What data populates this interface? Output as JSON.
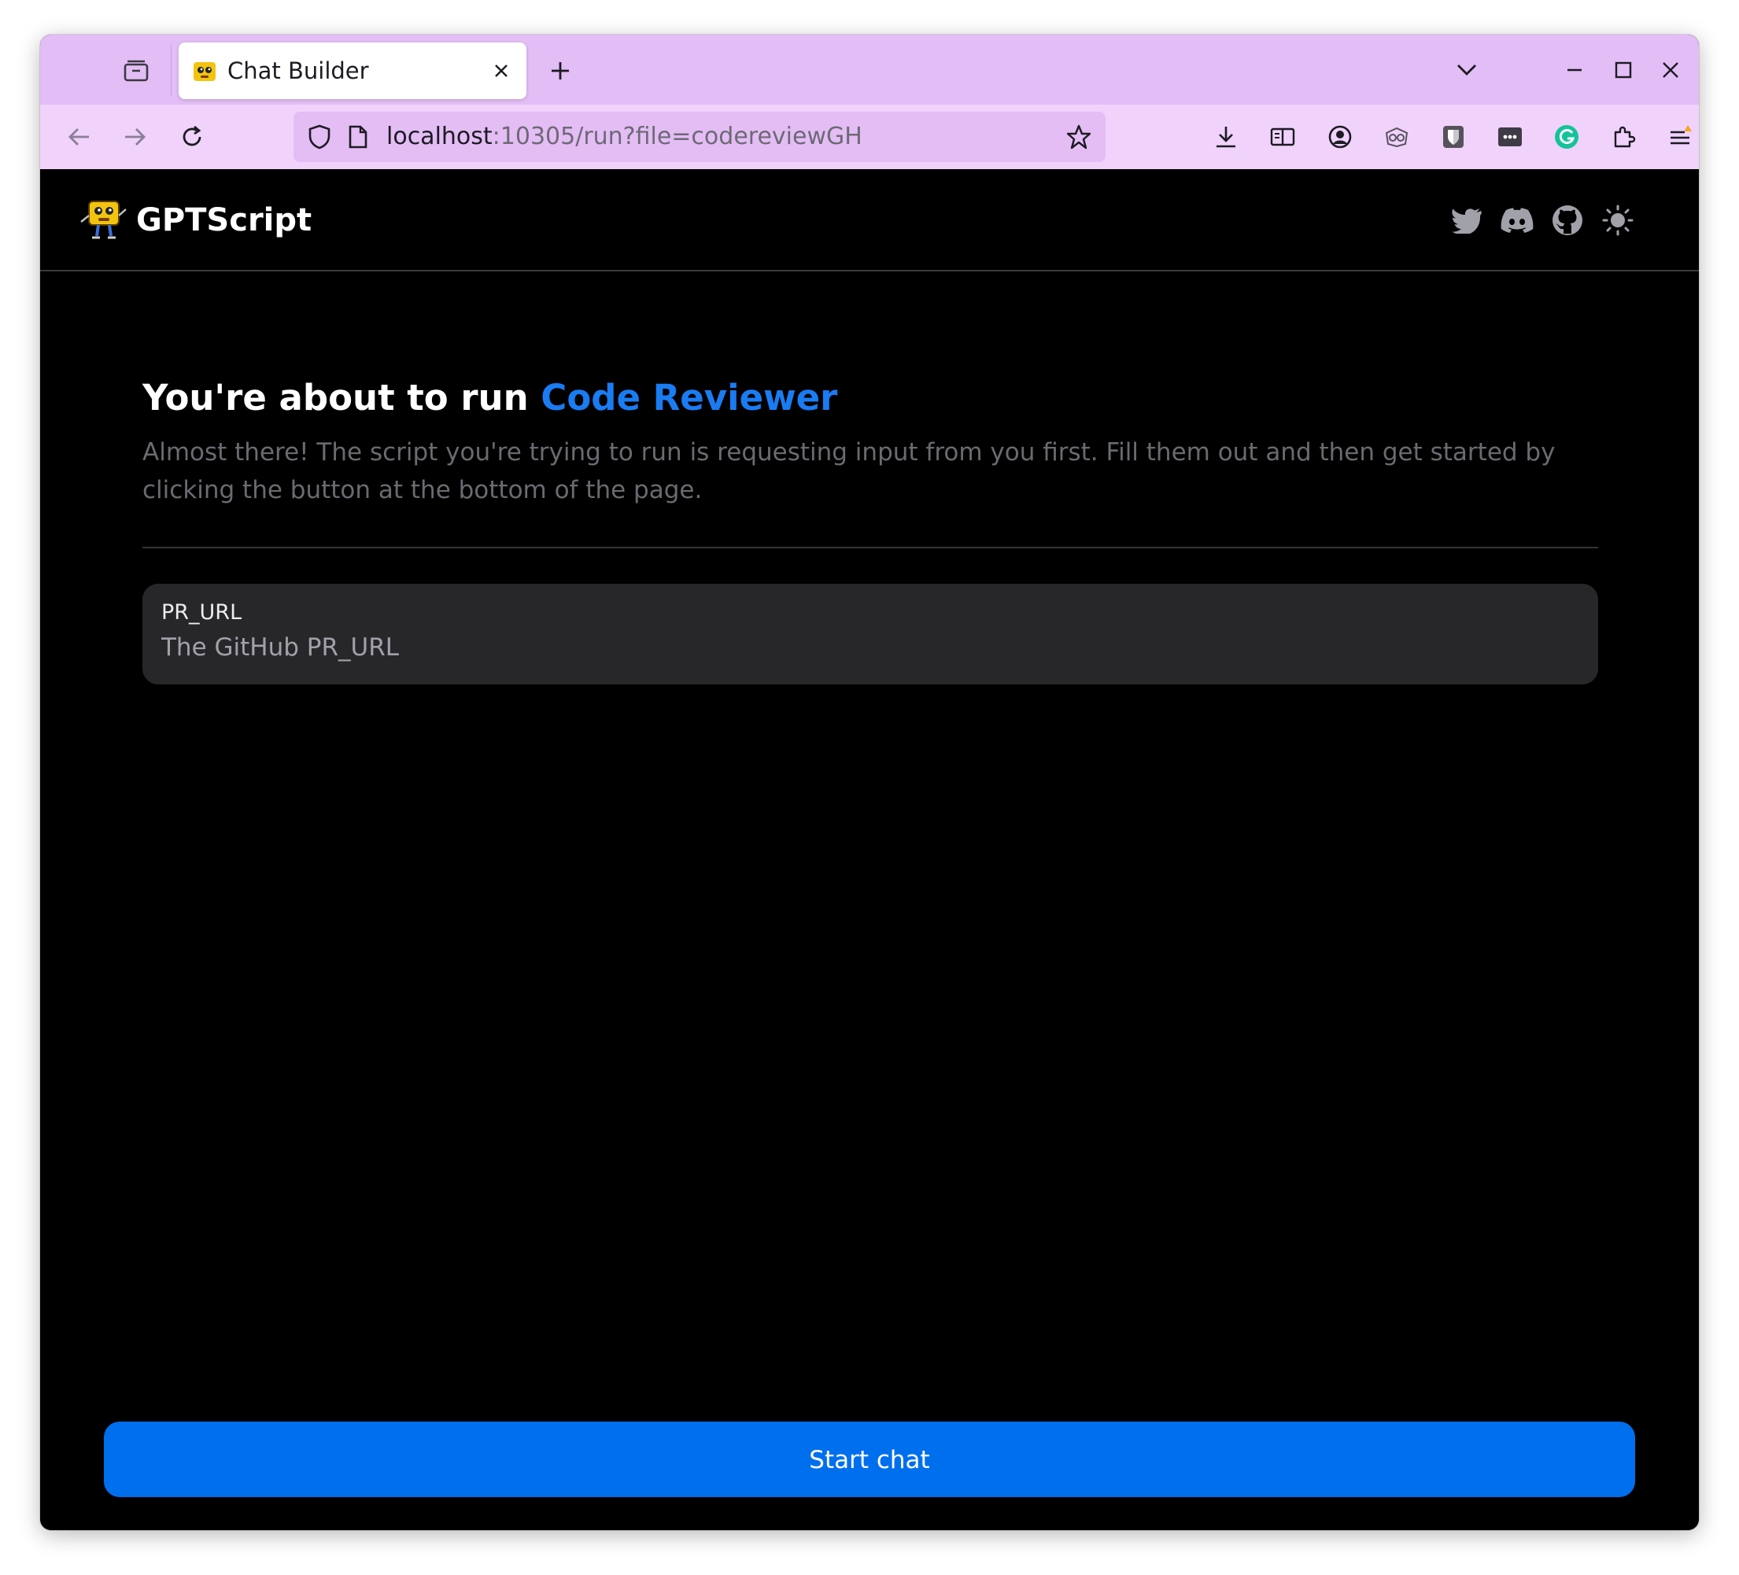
{
  "browser": {
    "tab": {
      "title": "Chat Builder"
    },
    "url": {
      "host": "localhost",
      "rest": ":10305/run?file=codereviewGH"
    }
  },
  "site": {
    "brand": "GPTScript",
    "header_icons": [
      "twitter-icon",
      "discord-icon",
      "github-icon",
      "theme-toggle-sun-icon"
    ]
  },
  "main": {
    "title_prefix": "You're about to run ",
    "tool_name": "Code Reviewer",
    "description": "Almost there! The script you're trying to run is requesting input from you first. Fill them out and then get started by clicking the button at the bottom of the page.",
    "fields": [
      {
        "label": "PR_URL",
        "placeholder": "The GitHub PR_URL",
        "value": ""
      }
    ],
    "start_button": "Start chat"
  },
  "colors": {
    "accent": "#1a7cf3",
    "button": "#006fee",
    "tab_strip": "#e3bdf5",
    "nav_bar": "#f0d2fb",
    "card": "#27272a",
    "page_bg": "#000000"
  }
}
